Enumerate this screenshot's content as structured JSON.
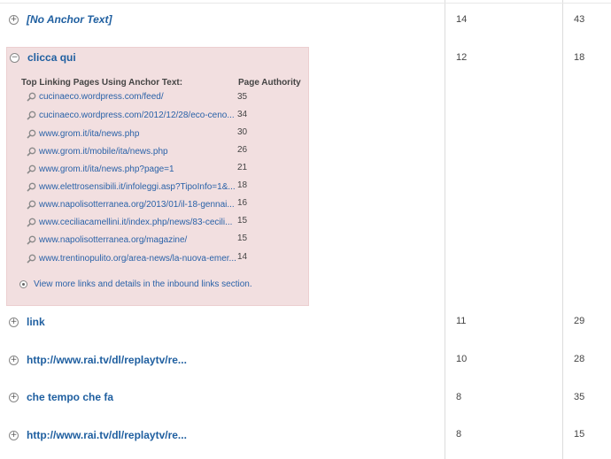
{
  "rows": [
    {
      "anchor": "[No Anchor Text]",
      "toggle": "+",
      "col1": "14",
      "col2": "43"
    },
    {
      "anchor": "clicca qui",
      "toggle": "−",
      "col1": "12",
      "col2": "18"
    },
    {
      "anchor": "link",
      "toggle": "+",
      "col1": "11",
      "col2": "29"
    },
    {
      "anchor": "http://www.rai.tv/dl/replaytv/re...",
      "toggle": "+",
      "col1": "10",
      "col2": "28"
    },
    {
      "anchor": "che tempo che fa",
      "toggle": "+",
      "col1": "8",
      "col2": "35"
    },
    {
      "anchor": "http://www.rai.tv/dl/replaytv/re...",
      "toggle": "+",
      "col1": "8",
      "col2": "15"
    }
  ],
  "expanded": {
    "header_pages": "Top Linking Pages Using Anchor Text:",
    "header_authority": "Page Authority",
    "links": [
      {
        "url": "cucinaeco.wordpress.com/feed/",
        "pa": "35"
      },
      {
        "url": "cucinaeco.wordpress.com/2012/12/28/eco-ceno...",
        "pa": "34"
      },
      {
        "url": "www.grom.it/ita/news.php",
        "pa": "30"
      },
      {
        "url": "www.grom.it/mobile/ita/news.php",
        "pa": "26"
      },
      {
        "url": "www.grom.it/ita/news.php?page=1",
        "pa": "21"
      },
      {
        "url": "www.elettrosensibili.it/infoleggi.asp?TipoInfo=1&...",
        "pa": "18"
      },
      {
        "url": "www.napolisotterranea.org/2013/01/il-18-gennai...",
        "pa": "16"
      },
      {
        "url": "www.ceciliacamellini.it/index.php/news/83-cecili...",
        "pa": "15"
      },
      {
        "url": "www.napolisotterranea.org/magazine/",
        "pa": "15"
      },
      {
        "url": "www.trentinopulito.org/area-news/la-nuova-emer...",
        "pa": "14"
      }
    ],
    "more_text": "View more links and details in the inbound links section."
  },
  "icons": {
    "expand": "plus-circle-icon",
    "collapse": "minus-circle-icon",
    "search": "magnifier-icon"
  }
}
